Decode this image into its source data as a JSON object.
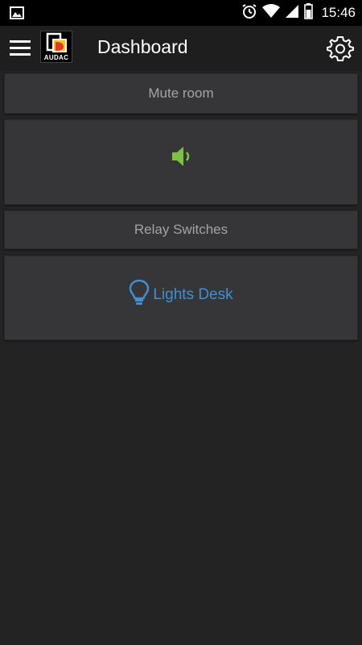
{
  "status_bar": {
    "time": "15:46",
    "icons": [
      "image-icon",
      "alarm-icon",
      "wifi-icon",
      "signal-icon",
      "battery-icon"
    ]
  },
  "header": {
    "logo_text": "AUDAC",
    "title": "Dashboard",
    "icons": [
      "hamburger-menu-icon",
      "settings-gear-icon"
    ]
  },
  "cards": {
    "mute_title": "Mute room",
    "mute_icon": "speaker-volume-icon",
    "relay_title": "Relay Switches",
    "lights_label": "Lights Desk",
    "lights_icon": "lightbulb-icon"
  },
  "colors": {
    "background": "#232324",
    "card": "#363638",
    "header": "#1e1e1f",
    "accent_green": "#7dc242",
    "accent_blue": "#3f8fd2",
    "muted_text": "#a3a3a3"
  }
}
